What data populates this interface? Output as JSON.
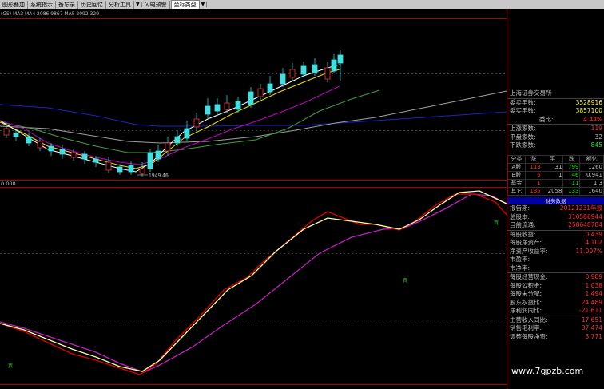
{
  "toolbar": {
    "items": [
      "图形叠加",
      "系统指示",
      "备忘录",
      "历史回忆",
      "分析工具",
      "闪电预警"
    ],
    "select_value": "坐标类型"
  },
  "indicators": {
    "main_legend": "(GS) MA3   MA4 2086.9867 MA5 2092.329",
    "sub_legend": "0.000"
  },
  "chart_annotations": {
    "low_price": "1949.46"
  },
  "info_panel": {
    "title": "上海证券交易所",
    "rows": [
      {
        "label": "委卖手数:",
        "value": "3528916"
      },
      {
        "label": "委买手数:",
        "value": "3857100"
      },
      {
        "label": "委比:",
        "value": "4.44%"
      },
      {
        "label": "上涨家数:",
        "value": "119"
      },
      {
        "label": "平盘家数:",
        "value": "32"
      },
      {
        "label": "下跌家数:",
        "value": "845"
      }
    ]
  },
  "class_table": {
    "headers": [
      "分类",
      "涨",
      "平",
      "跌",
      "额亿"
    ],
    "rows": [
      [
        "A股",
        "113",
        "31",
        "799",
        "1260"
      ],
      [
        "B股",
        "6",
        "1",
        "46",
        "0.941"
      ],
      [
        "基金",
        "1",
        "",
        "11",
        "1.3"
      ],
      [
        "其它",
        "135",
        "2058",
        "133",
        "1640"
      ]
    ]
  },
  "finance_panel": {
    "title": "财务数据",
    "rows": [
      {
        "label": "报告期:",
        "value": "20121231年报"
      },
      {
        "label": "总股本:",
        "value": "310586944"
      },
      {
        "label": "目前流通:",
        "value": "258648784"
      },
      {
        "label": "每股收益:",
        "value": "0.439"
      },
      {
        "label": "每股净资产:",
        "value": "4.102"
      },
      {
        "label": "净资产收益率:",
        "value": "11.007%"
      },
      {
        "label": "市盈率:",
        "value": ""
      },
      {
        "label": "市净率:",
        "value": ""
      },
      {
        "label": "每股经营现金:",
        "value": "0.989"
      },
      {
        "label": "每股公积金:",
        "value": "1.038"
      },
      {
        "label": "每股未分配:",
        "value": "1.494"
      },
      {
        "label": "股东权益比:",
        "value": "24.489"
      },
      {
        "label": "净利润同比:",
        "value": "-21.611"
      },
      {
        "label": "主营收入同比:",
        "value": "17.651"
      },
      {
        "label": "销售毛利率:",
        "value": "37.474"
      },
      {
        "label": "调整每股净资:",
        "value": "3.771"
      }
    ]
  },
  "watermark": "www.7gpzb.com",
  "colors": {
    "up": "#00e0e0",
    "down": "#00e0e0",
    "ma_white": "#ffffff",
    "ma_yellow": "#f0e000",
    "ma_magenta": "#c000c0",
    "ma_green": "#40a040",
    "ma_gray": "#a0a0a0",
    "ma_blue": "#2020c0",
    "ind_red": "#e00000",
    "ind_yellow": "#ffffa0",
    "ind_magenta": "#c020c0",
    "red_text": "#ff3030",
    "yellow_text": "#ffff40",
    "header_bg": "#0000a0"
  }
}
